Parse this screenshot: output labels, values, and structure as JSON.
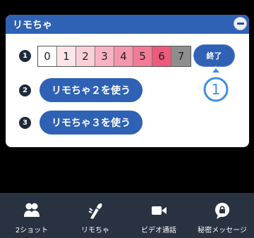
{
  "panel": {
    "title": "リモちゃ",
    "minimize_icon": "minus-circle-icon"
  },
  "steps": [
    "1",
    "2",
    "3"
  ],
  "level_cells": [
    {
      "label": "0",
      "color": "#ffffff"
    },
    {
      "label": "1",
      "color": "#fde6ea"
    },
    {
      "label": "2",
      "color": "#fbcfd8"
    },
    {
      "label": "3",
      "color": "#f8b3c2"
    },
    {
      "label": "4",
      "color": "#f597ab"
    },
    {
      "label": "5",
      "color": "#f27b96"
    },
    {
      "label": "6",
      "color": "#ee5a7b"
    },
    {
      "label": "7",
      "color": "#8e8e8e"
    }
  ],
  "actions": {
    "end_label": "終了",
    "use_remocha2_label": "リモちゃ２を使う",
    "use_remocha3_label": "リモちゃ３を使う"
  },
  "pointer_marker": {
    "label": "1"
  },
  "tabbar": {
    "items": [
      {
        "label": "2ショット",
        "icon": "two-people-icon"
      },
      {
        "label": "リモちゃ",
        "icon": "remocha-device-icon"
      },
      {
        "label": "ビデオ通話",
        "icon": "video-camera-icon"
      },
      {
        "label": "秘密メッセージ",
        "icon": "lock-message-icon"
      }
    ]
  },
  "colors": {
    "accent": "#2f61b4",
    "tabbar_bg": "#293241",
    "background": "#000000"
  }
}
